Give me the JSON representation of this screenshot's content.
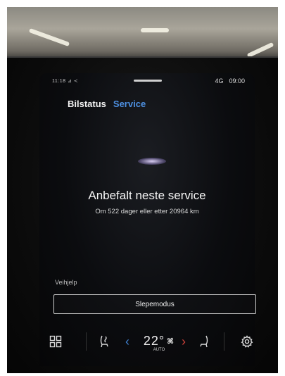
{
  "status": {
    "left": "11:18 ⊿ ≺",
    "network": "4G",
    "time": "09:00"
  },
  "tabs": [
    {
      "label": "Bilstatus"
    },
    {
      "label": "Service"
    }
  ],
  "service": {
    "title": "Anbefalt neste service",
    "subtitle": "Om 522 dager eller etter 20964 km"
  },
  "roadside": {
    "label": "Veihjelp",
    "tow_button": "Slepemodus"
  },
  "climate": {
    "temperature": "22°",
    "mode": "AUTO"
  },
  "colors": {
    "accent": "#4d8fe0",
    "temp_down": "#3f7fd0",
    "temp_up": "#d0423a"
  },
  "icons": [
    "home-grid-icon",
    "heated-seat-left-icon",
    "fan-icon",
    "heated-seat-right-icon",
    "gear-icon"
  ]
}
